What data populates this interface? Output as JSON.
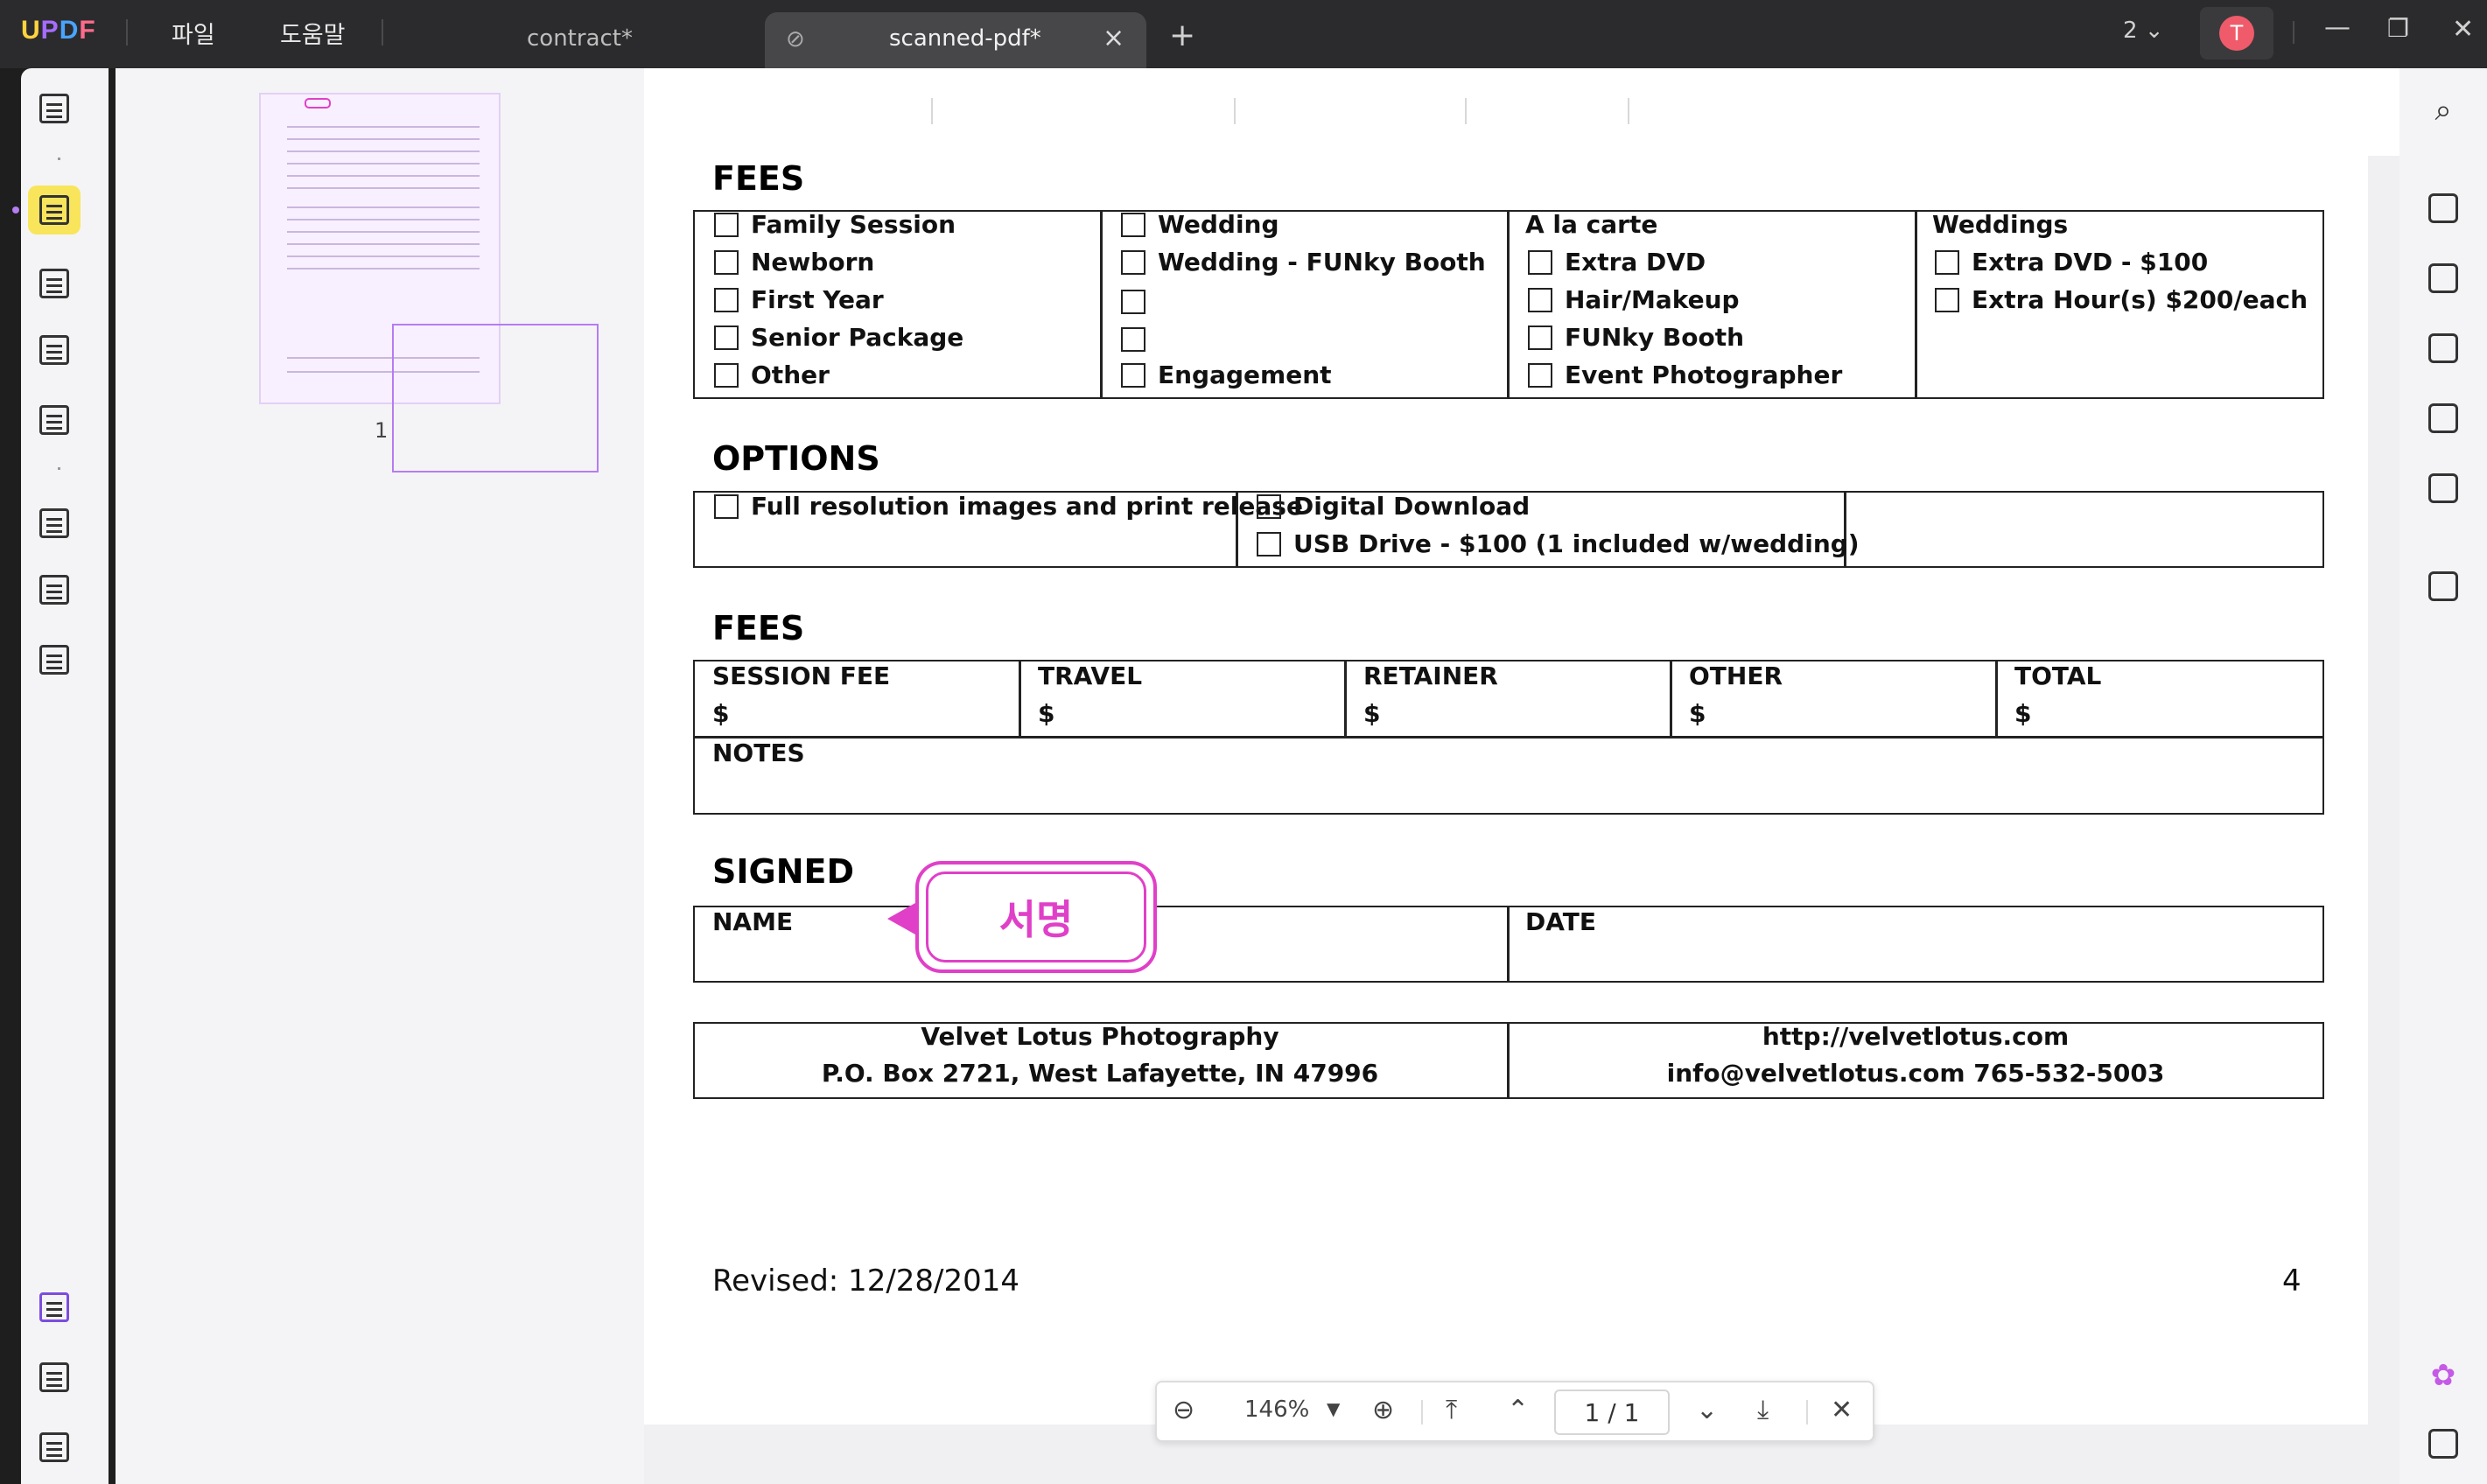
{
  "app": {
    "brand": "UPDF",
    "menus": [
      "파일",
      "도움말"
    ],
    "page_count": "2",
    "avatar": "T"
  },
  "tabs": [
    {
      "label": "contract*"
    },
    {
      "label": "scanned-pdf*"
    }
  ],
  "thumbnails": [
    {
      "page": "1"
    }
  ],
  "document": {
    "fees_heading": "FEES",
    "packages": {
      "col1": [
        "Family Session",
        "Newborn",
        "First Year",
        "Senior Package",
        "Other"
      ],
      "col2": [
        "Wedding",
        "Wedding - FUNky Booth",
        "",
        "",
        "Engagement"
      ],
      "col3_head": "A la carte",
      "col3": [
        "Extra DVD",
        "Hair/Makeup",
        "FUNky Booth",
        "Event Photographer"
      ],
      "col4_head": "Weddings",
      "col4": [
        "Extra DVD - $100",
        "Extra Hour(s) $200/each"
      ]
    },
    "options_heading": "OPTIONS",
    "options": {
      "col1": [
        "Full resolution images and print release"
      ],
      "col2": [
        "Digital Download",
        "USB Drive - $100 (1 included w/wedding)"
      ]
    },
    "fees2_heading": "FEES",
    "fees_cols": [
      {
        "label": "SESSION FEE",
        "value": "$"
      },
      {
        "label": "TRAVEL",
        "value": "$"
      },
      {
        "label": "RETAINER",
        "value": "$"
      },
      {
        "label": "OTHER",
        "value": "$"
      },
      {
        "label": "TOTAL",
        "value": "$"
      }
    ],
    "notes_label": "NOTES",
    "signed_heading": "SIGNED",
    "name_label": "NAME",
    "date_label": "DATE",
    "stamp_text": "서명",
    "footer": {
      "company": "Velvet Lotus Photography",
      "address": "P.O. Box 2721, West Lafayette, IN 47996",
      "url": "http://velvetlotus.com",
      "contact": "info@velvetlotus.com 765-532-5003"
    },
    "revised": "Revised: 12/28/2014",
    "page_number": "4"
  },
  "zoom": {
    "level": "146%",
    "current_page": "1",
    "separator": "/",
    "total_pages": "1"
  },
  "colors": {
    "stamp": "#e040c8",
    "highlight_tool": "#f9e55c",
    "thumb_select": "#b67cf2"
  }
}
